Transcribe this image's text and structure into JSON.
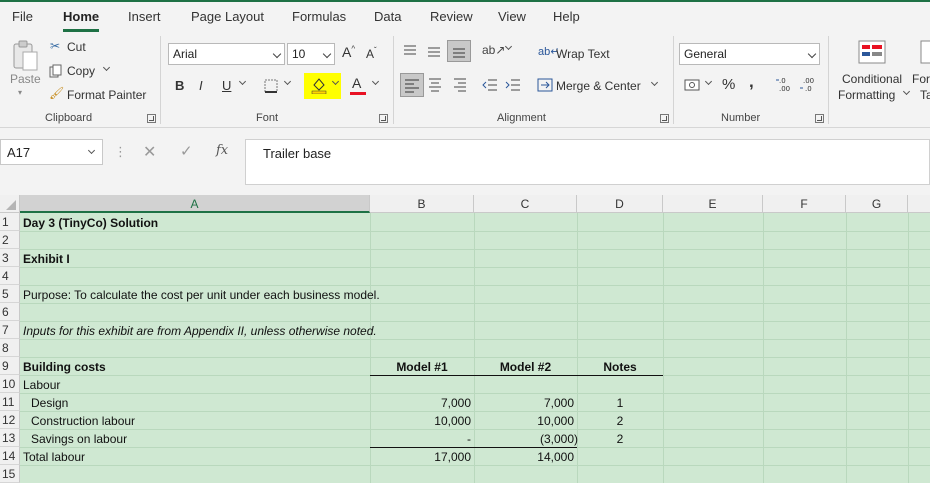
{
  "menu": {
    "tabs": [
      "File",
      "Home",
      "Insert",
      "Page Layout",
      "Formulas",
      "Data",
      "Review",
      "View",
      "Help"
    ]
  },
  "ribbon": {
    "clipboard": {
      "paste": "Paste",
      "cut": "Cut",
      "copy": "Copy",
      "format_painter": "Format Painter",
      "label": "Clipboard"
    },
    "font": {
      "name": "Arial",
      "size": "10",
      "bold": "B",
      "italic": "I",
      "underline": "U",
      "font_color_letter": "A",
      "label": "Font"
    },
    "alignment": {
      "wrap_text": "Wrap Text",
      "merge_center": "Merge & Center",
      "label": "Alignment"
    },
    "number": {
      "format": "General",
      "percent": "%",
      "comma": ",",
      "label": "Number"
    },
    "styles": {
      "conditional": "Conditional",
      "formatting": "Formatting",
      "next_partial_1": "For",
      "next_partial_2": "Ta"
    },
    "colors": {
      "highlight": "#ffff00",
      "font_color": "#e81123",
      "accent": "#1e7145"
    }
  },
  "formula_bar": {
    "name_box": "A17",
    "content": "Trailer base"
  },
  "sheet": {
    "columns": [
      "A",
      "B",
      "C",
      "D",
      "E",
      "F",
      "G"
    ],
    "rows": [
      "1",
      "2",
      "3",
      "4",
      "5",
      "6",
      "7",
      "8",
      "9",
      "10",
      "11",
      "12",
      "13",
      "14",
      "15"
    ],
    "cells": {
      "a1": "Day 3 (TinyCo) Solution",
      "a3": "Exhibit I",
      "a5": "Purpose: To calculate the cost per unit under each business model.",
      "a7": "Inputs for this exhibit are from Appendix II, unless otherwise noted.",
      "a9": "Building costs",
      "b9": "Model #1",
      "c9": "Model #2",
      "d9": "Notes",
      "a10": "Labour",
      "a11": "  Design",
      "b11": "7,000",
      "c11": "7,000",
      "d11": "1",
      "a12": "  Construction labour",
      "b12": "10,000",
      "c12": "10,000",
      "d12": "2",
      "a13": "  Savings on labour",
      "b13": "-",
      "c13": "(3,000)",
      "d13": "2",
      "a14": "Total labour",
      "b14": "17,000",
      "c14": "14,000"
    }
  }
}
